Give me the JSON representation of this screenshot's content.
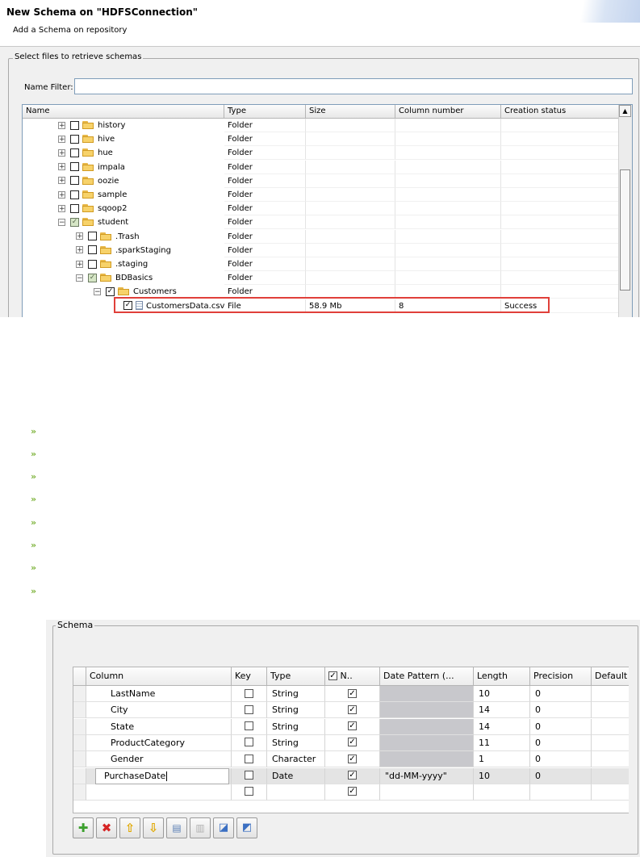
{
  "dialog": {
    "title": "New Schema on \"HDFSConnection\"",
    "subtitle": "Add a Schema on repository",
    "group_label": "Select files to retrieve schemas",
    "filter_label": "Name Filter:",
    "filter_value": "",
    "columns": [
      "Name",
      "Type",
      "Size",
      "Column number",
      "Creation status"
    ],
    "rows": [
      {
        "name": "history",
        "type": "Folder",
        "size": "",
        "cols": "",
        "status": ""
      },
      {
        "name": "hive",
        "type": "Folder",
        "size": "",
        "cols": "",
        "status": ""
      },
      {
        "name": "hue",
        "type": "Folder",
        "size": "",
        "cols": "",
        "status": ""
      },
      {
        "name": "impala",
        "type": "Folder",
        "size": "",
        "cols": "",
        "status": ""
      },
      {
        "name": "oozie",
        "type": "Folder",
        "size": "",
        "cols": "",
        "status": ""
      },
      {
        "name": "sample",
        "type": "Folder",
        "size": "",
        "cols": "",
        "status": ""
      },
      {
        "name": "sqoop2",
        "type": "Folder",
        "size": "",
        "cols": "",
        "status": ""
      },
      {
        "name": "student",
        "type": "Folder",
        "size": "",
        "cols": "",
        "status": ""
      },
      {
        "name": ".Trash",
        "type": "Folder",
        "size": "",
        "cols": "",
        "status": ""
      },
      {
        "name": ".sparkStaging",
        "type": "Folder",
        "size": "",
        "cols": "",
        "status": ""
      },
      {
        "name": ".staging",
        "type": "Folder",
        "size": "",
        "cols": "",
        "status": ""
      },
      {
        "name": "BDBasics",
        "type": "Folder",
        "size": "",
        "cols": "",
        "status": ""
      },
      {
        "name": "Customers",
        "type": "Folder",
        "size": "",
        "cols": "",
        "status": ""
      },
      {
        "name": "CustomersData.csv",
        "type": "File",
        "size": "58.9 Mb",
        "cols": "8",
        "status": "Success"
      }
    ]
  },
  "schema": {
    "group_label": "Schema",
    "columns": [
      "Column",
      "Key",
      "Type",
      "N..",
      "Date Pattern (...",
      "Length",
      "Precision",
      "Default"
    ],
    "rows": [
      {
        "column": "LastName",
        "key": false,
        "type": "String",
        "nullable": true,
        "pattern": "",
        "length": "10",
        "precision": "0"
      },
      {
        "column": "City",
        "key": false,
        "type": "String",
        "nullable": true,
        "pattern": "",
        "length": "14",
        "precision": "0"
      },
      {
        "column": "State",
        "key": false,
        "type": "String",
        "nullable": true,
        "pattern": "",
        "length": "14",
        "precision": "0"
      },
      {
        "column": "ProductCategory",
        "key": false,
        "type": "String",
        "nullable": true,
        "pattern": "",
        "length": "11",
        "precision": "0"
      },
      {
        "column": "Gender",
        "key": false,
        "type": "Character",
        "nullable": true,
        "pattern": "",
        "length": "1",
        "precision": "0"
      },
      {
        "column": "PurchaseDate",
        "key": false,
        "type": "Date",
        "nullable": true,
        "pattern": "\"dd-MM-yyyy\"",
        "length": "10",
        "precision": "0"
      },
      {
        "column": "",
        "key": false,
        "type": "",
        "nullable": true,
        "pattern": "",
        "length": "",
        "precision": ""
      }
    ],
    "toolbar": [
      "add-icon",
      "remove-icon",
      "move-up-icon",
      "move-down-icon",
      "copy-icon",
      "paste-icon",
      "import-icon",
      "export-icon"
    ]
  },
  "colors": {
    "highlight": "#e0403a",
    "bullet": "#7db33a",
    "folder": "#f7d26a"
  }
}
